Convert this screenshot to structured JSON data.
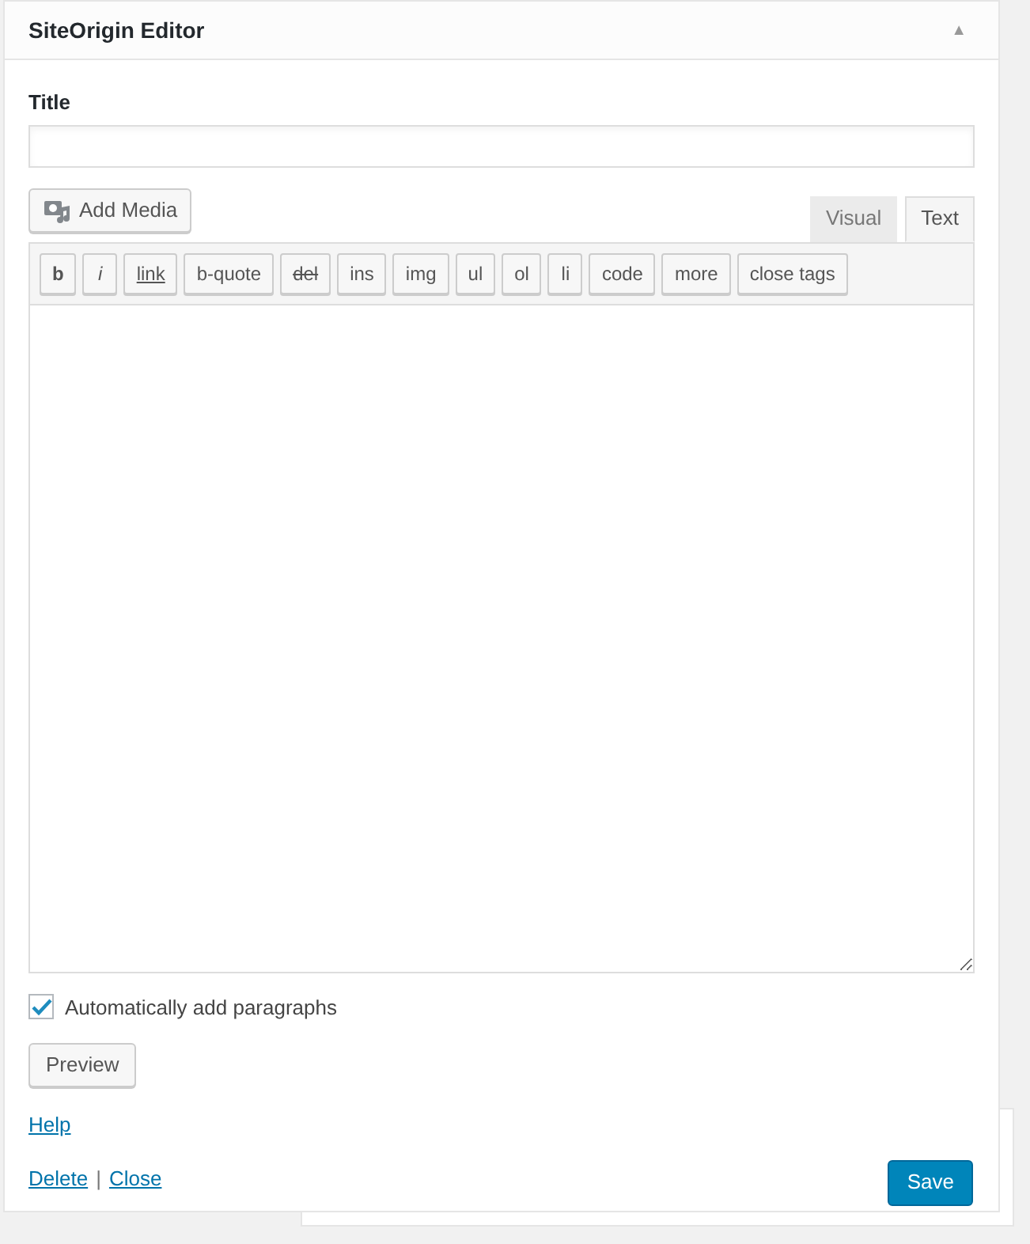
{
  "panel": {
    "title": "SiteOrigin Editor",
    "collapse_glyph": "▲"
  },
  "title_field": {
    "label": "Title"
  },
  "add_media": {
    "label": "Add Media"
  },
  "editor_tabs": [
    {
      "label": "Visual",
      "selected": false
    },
    {
      "label": "Text",
      "selected": true
    }
  ],
  "quicktags": [
    {
      "label": "b",
      "kind": "bold"
    },
    {
      "label": "i",
      "kind": "italic"
    },
    {
      "label": "link",
      "kind": "underline"
    },
    {
      "label": "b-quote",
      "kind": "plain"
    },
    {
      "label": "del",
      "kind": "strike"
    },
    {
      "label": "ins",
      "kind": "plain"
    },
    {
      "label": "img",
      "kind": "plain"
    },
    {
      "label": "ul",
      "kind": "plain"
    },
    {
      "label": "ol",
      "kind": "plain"
    },
    {
      "label": "li",
      "kind": "plain"
    },
    {
      "label": "code",
      "kind": "plain"
    },
    {
      "label": "more",
      "kind": "plain"
    },
    {
      "label": "close tags",
      "kind": "plain"
    }
  ],
  "auto_paragraphs": {
    "label": "Automatically add paragraphs",
    "checked": true
  },
  "preview_button": "Preview",
  "help_link": "Help",
  "footer_links": [
    "Delete",
    "Close"
  ],
  "link_separator": "|",
  "save_button": "Save"
}
